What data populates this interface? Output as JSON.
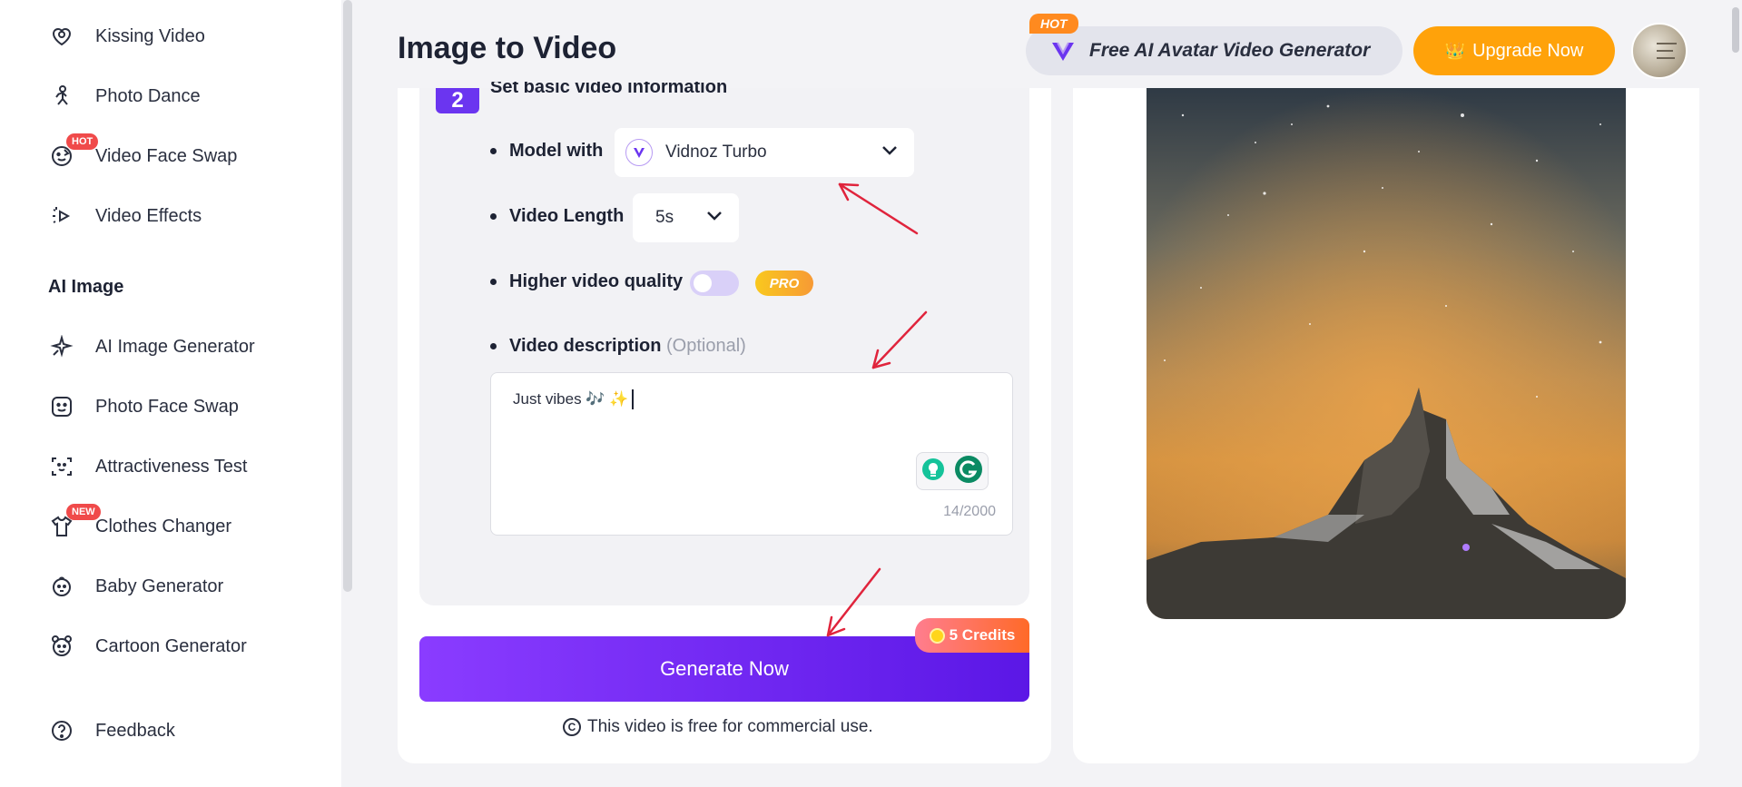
{
  "sidebar": {
    "items_top": [
      {
        "label": "Kissing Video",
        "icon": "heart-icon"
      },
      {
        "label": "Photo Dance",
        "icon": "dance-icon"
      },
      {
        "label": "Video Face Swap",
        "icon": "face-swap-icon",
        "badge": "HOT"
      },
      {
        "label": "Video Effects",
        "icon": "video-effects-icon"
      }
    ],
    "section_label": "AI Image",
    "items_image": [
      {
        "label": "AI Image Generator",
        "icon": "sparkle-icon"
      },
      {
        "label": "Photo Face Swap",
        "icon": "face-icon"
      },
      {
        "label": "Attractiveness Test",
        "icon": "scan-face-icon"
      },
      {
        "label": "Clothes Changer",
        "icon": "shirt-icon",
        "badge": "NEW"
      },
      {
        "label": "Baby Generator",
        "icon": "baby-icon"
      },
      {
        "label": "Cartoon Generator",
        "icon": "cartoon-icon"
      }
    ],
    "feedback": {
      "label": "Feedback",
      "icon": "help-circle-icon"
    }
  },
  "header": {
    "title": "Image to Video",
    "promo": {
      "hot": "HOT",
      "text": "Free AI Avatar Video Generator"
    },
    "upgrade_label": "Upgrade Now"
  },
  "step": {
    "number": "2",
    "title": "Set basic video information",
    "model_label": "Model with",
    "model_value": "Vidnoz Turbo",
    "length_label": "Video Length",
    "length_value": "5s",
    "quality_label": "Higher video quality",
    "quality_enabled": false,
    "pro_badge": "PRO",
    "description_label": "Video description",
    "description_optional": "(Optional)",
    "description_value": "Just vibes 🎶 ✨",
    "description_counter": "14/2000"
  },
  "generate": {
    "label": "Generate Now",
    "credits": "5 Credits",
    "note": "This video is free for commercial use."
  },
  "colors": {
    "accent": "#6b35f0",
    "upgrade": "#ffa20a",
    "annotation_arrow": "#e0243c"
  }
}
